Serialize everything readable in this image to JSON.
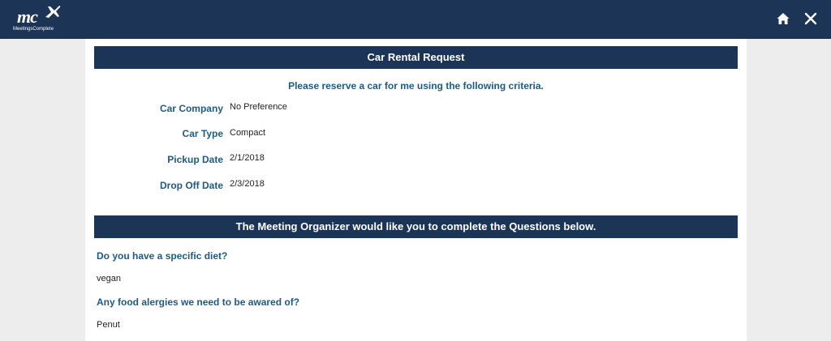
{
  "header": {
    "logo_text": "mc",
    "logo_subtext": "MeetingsComplete",
    "home_icon": "home-icon",
    "close_icon": "close-icon"
  },
  "car_rental": {
    "title": "Car Rental Request",
    "intro": "Please reserve a car for me using the following criteria.",
    "fields": [
      {
        "label": "Car Company",
        "value": "No Preference"
      },
      {
        "label": "Car Type",
        "value": "Compact"
      },
      {
        "label": "Pickup Date",
        "value": "2/1/2018"
      },
      {
        "label": "Drop Off Date",
        "value": "2/3/2018"
      }
    ]
  },
  "questions": {
    "title": "The Meeting Organizer would like you to complete the Questions below.",
    "items": [
      {
        "question": "Do you have a specific diet?",
        "answer": "vegan"
      },
      {
        "question": "Any food alergies we need to be awared of?",
        "answer": "Penut"
      }
    ]
  },
  "colors": {
    "navy": "#1c3557",
    "label_blue": "#1f5a80",
    "page_bg": "#ededed"
  }
}
